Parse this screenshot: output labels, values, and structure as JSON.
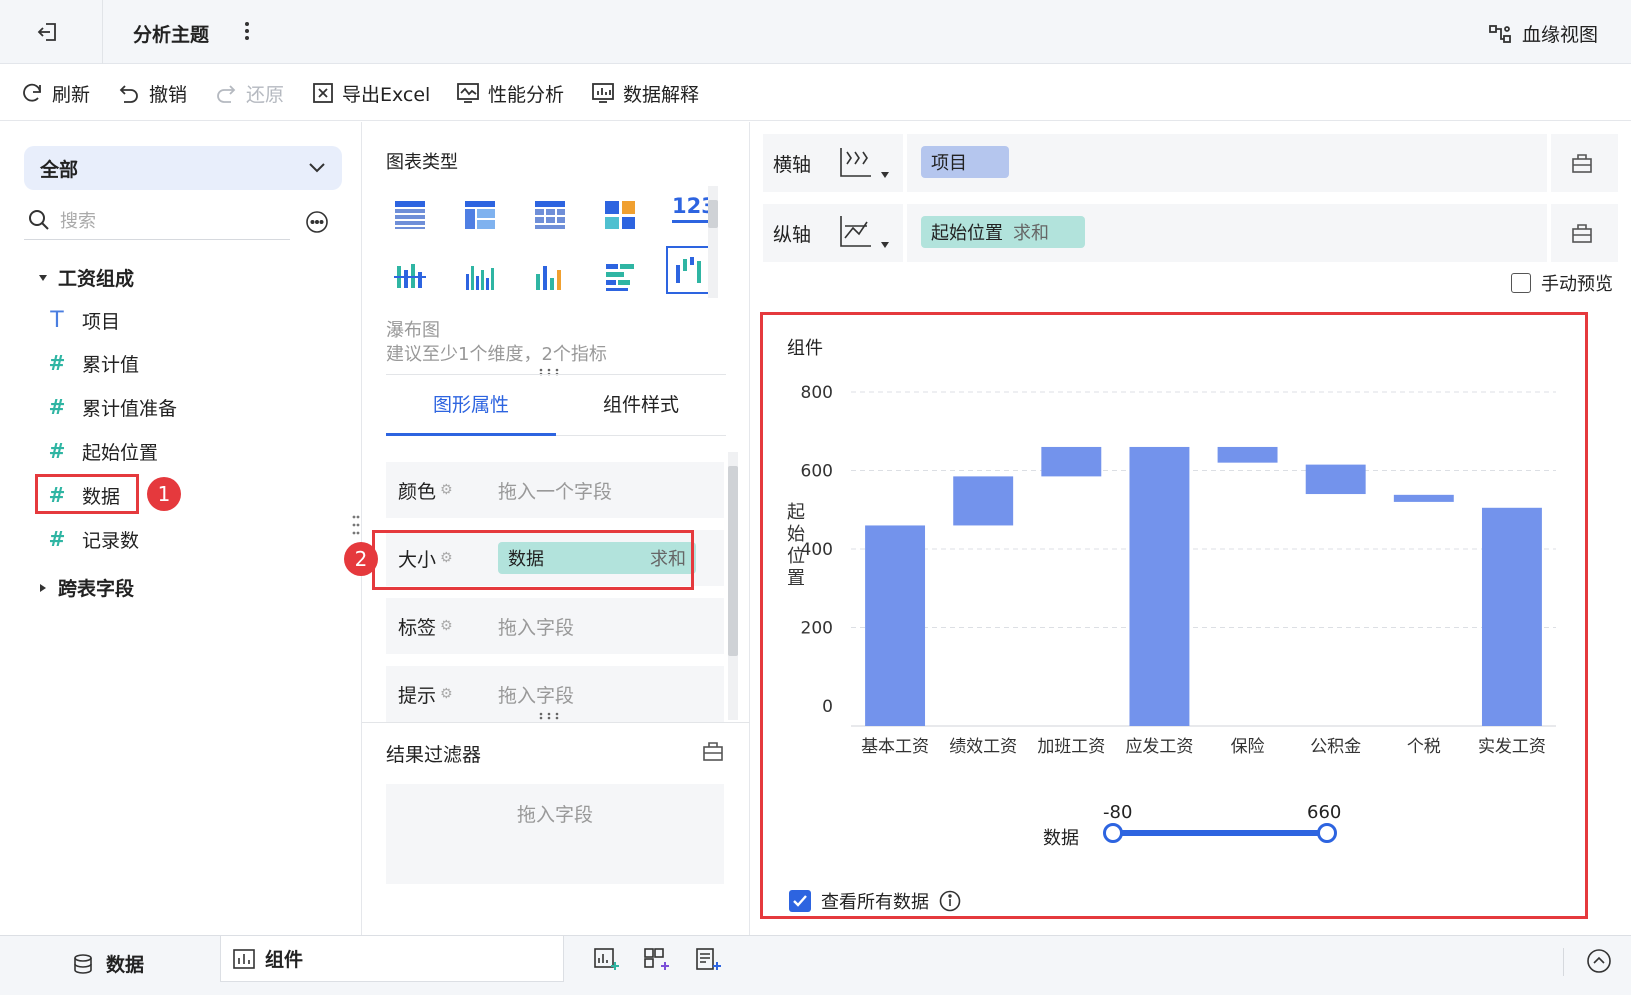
{
  "header": {
    "title": "分析主题",
    "lineage_label": "血缘视图"
  },
  "toolbar": {
    "refresh": "刷新",
    "undo": "撤销",
    "redo": "还原",
    "export_excel": "导出Excel",
    "performance": "性能分析",
    "data_explain": "数据解释"
  },
  "fields": {
    "scope_selected": "全部",
    "search_placeholder": "搜索",
    "group_name": "工资组成",
    "items": [
      "项目",
      "累计值",
      "累计值准备",
      "起始位置",
      "数据",
      "记录数"
    ],
    "cross_table": "跨表字段"
  },
  "chart_types": {
    "title": "图表类型",
    "selected_name": "瀑布图",
    "selected_hint": "建议至少1个维度，2个指标",
    "number_icon_text": "123"
  },
  "props": {
    "tabs": [
      "图形属性",
      "组件样式"
    ],
    "color_label": "颜色",
    "color_placeholder": "拖入一个字段",
    "size_label": "大小",
    "size_field": "数据",
    "size_agg": "求和",
    "label_label": "标签",
    "label_placeholder": "拖入字段",
    "tooltip_label": "提示",
    "tooltip_placeholder": "拖入字段"
  },
  "result_filter": {
    "title": "结果过滤器",
    "placeholder": "拖入字段"
  },
  "axes": {
    "x_label": "横轴",
    "x_field": "项目",
    "y_label": "纵轴",
    "y_field": "起始位置",
    "y_agg": "求和",
    "manual_preview": "手动预览"
  },
  "widget": {
    "title": "组件",
    "view_all": "查看所有数据"
  },
  "chart_data": {
    "type": "bar",
    "subtype": "waterfall",
    "categories": [
      "基本工资",
      "绩效工资",
      "加班工资",
      "应发工资",
      "保险",
      "公积金",
      "个税",
      "实发工资"
    ],
    "series": [
      {
        "base": [
          0,
          460,
          585,
          0,
          620,
          540,
          520,
          0
        ],
        "values": [
          460,
          125,
          75,
          660,
          40,
          75,
          18,
          505
        ]
      }
    ],
    "ylabel": "起始位置",
    "yticks": [
      0,
      200,
      400,
      600,
      800
    ],
    "ylim": [
      0,
      800
    ],
    "bar_color": "#7393ec",
    "grid": true
  },
  "range_slider": {
    "label": "数据",
    "min_label": "-80",
    "max_label": "660"
  },
  "badges": [
    "1",
    "2"
  ],
  "bottom": {
    "data_tab": "数据",
    "widget_tab": "组件"
  },
  "colors": {
    "accent": "#2d64e0",
    "teal_pill": "#b2e3dc",
    "blue_pill": "#b5c6ee",
    "highlight": "#e5393d"
  }
}
